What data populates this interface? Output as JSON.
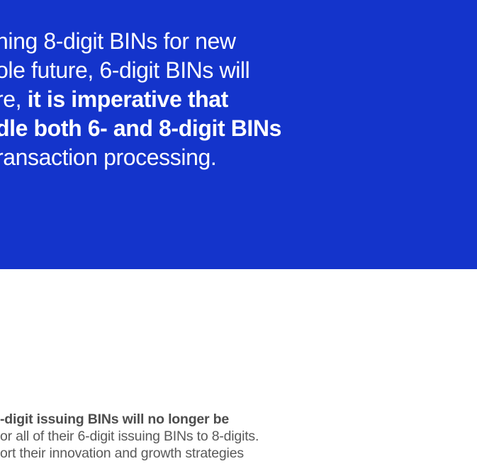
{
  "colors": {
    "panel_background": "#1434CB",
    "panel_text": "#FFFFFF",
    "heading_text": "#4D4D4D",
    "body_text": "#595959",
    "page_background": "#FFFFFF"
  },
  "callout": {
    "line1": "ning 8-digit BINs for new",
    "line2": "ole future, 6-digit BINs will",
    "line3_regular": "re, ",
    "line3_bold": "it is imperative that",
    "line4_bold": "dle both 6- and 8-digit BINs",
    "line5": "ransaction processing."
  },
  "body": {
    "heading_line": "-digit issuing BINs will no longer be",
    "line2": "or all of their 6-digit issuing BINs to 8-digits.",
    "line3": "ort their innovation and growth strategies"
  }
}
